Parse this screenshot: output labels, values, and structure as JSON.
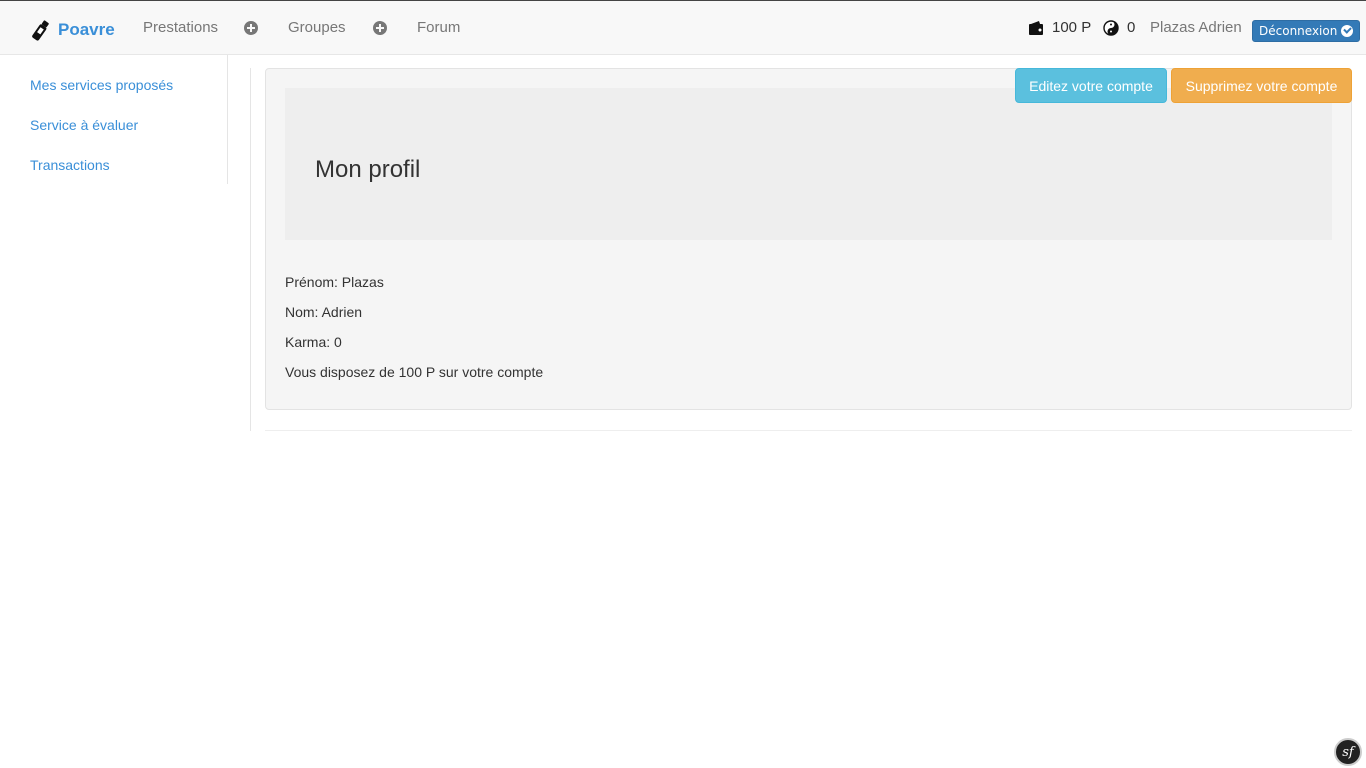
{
  "navbar": {
    "brand": "Poavre",
    "links": [
      "Prestations",
      "Groupes",
      "Forum"
    ],
    "wallet": "100 P",
    "karma": "0",
    "user": "Plazas Adrien",
    "logout": "Déconnexion"
  },
  "sidebar": {
    "items": [
      "Mes services proposés",
      "Service à évaluer",
      "Transactions"
    ]
  },
  "profile": {
    "title": "Mon profil",
    "edit_button": "Editez votre compte",
    "delete_button": "Supprimez votre compte",
    "lines": [
      "Prénom: Plazas",
      "Nom: Adrien",
      "Karma: 0",
      "Vous disposez de 100 P sur votre compte"
    ]
  },
  "footer": {
    "badge": "sf"
  }
}
